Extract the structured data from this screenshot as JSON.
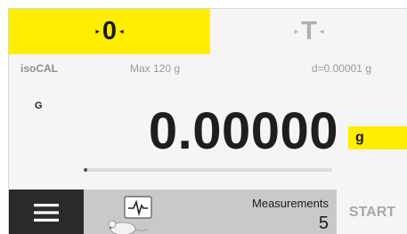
{
  "keys": {
    "zero": {
      "label": "0",
      "active_color": "#ffee00"
    },
    "tare": {
      "label": "T"
    }
  },
  "info": {
    "mode": "isoCAL",
    "max": "Max 120 g",
    "readability": "d=0.00001 g"
  },
  "display": {
    "unit_small": "G",
    "weight": "0.00000",
    "unit": "g",
    "capacity_used_fraction": 0.0
  },
  "bottom_bar": {
    "menu_icon": "hamburger-menu-icon",
    "app_icon": "mouse-pulse-icon",
    "measurements_label": "Measurements",
    "measurements_count": "5",
    "start_label": "START"
  },
  "colors": {
    "accent": "#ffee00",
    "dark": "#2a2a2a",
    "strip": "#c9c9c9"
  }
}
